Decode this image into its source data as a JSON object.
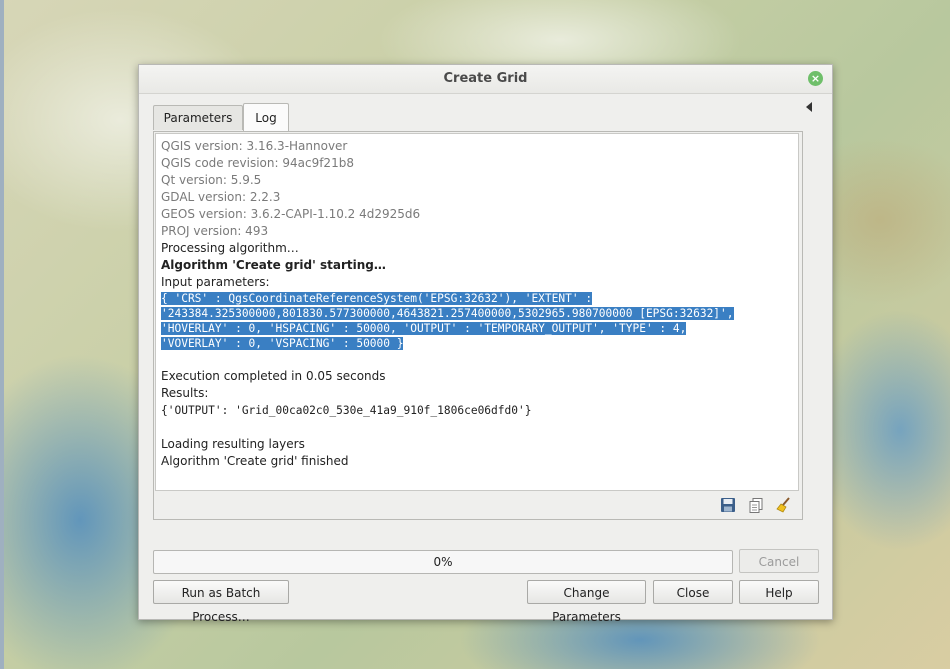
{
  "dialog": {
    "title": "Create Grid"
  },
  "tabs": {
    "parameters": "Parameters",
    "log": "Log"
  },
  "log": {
    "gray_lines": [
      "QGIS version: 3.16.3-Hannover",
      "QGIS code revision: 94ac9f21b8",
      "Qt version: 5.9.5",
      "GDAL version: 2.2.3",
      "GEOS version: 3.6.2-CAPI-1.10.2 4d2925d6",
      "PROJ version: 493"
    ],
    "processing": "Processing algorithm…",
    "starting": "Algorithm 'Create grid' starting…",
    "input_label": "Input parameters:",
    "params_lines": [
      "{ 'CRS' : QgsCoordinateReferenceSystem('EPSG:32632'), 'EXTENT' :",
      "'243384.325300000,801830.577300000,4643821.257400000,5302965.980700000 [EPSG:32632]',",
      "'HOVERLAY' : 0, 'HSPACING' : 50000, 'OUTPUT' : 'TEMPORARY_OUTPUT', 'TYPE' : 4,",
      "'VOVERLAY' : 0, 'VSPACING' : 50000 }"
    ],
    "execution": "Execution completed in 0.05 seconds",
    "results_label": "Results:",
    "results_value": "{'OUTPUT': 'Grid_00ca02c0_530e_41a9_910f_1806ce06dfd0'}",
    "loading": "Loading resulting layers",
    "finished": "Algorithm 'Create grid' finished"
  },
  "toolbar_icons": [
    "save-log-icon",
    "copy-log-icon",
    "clear-log-icon"
  ],
  "progress": {
    "value": 0,
    "label": "0%"
  },
  "buttons": {
    "cancel": "Cancel",
    "batch": "Run as Batch Process…",
    "change_params": "Change Parameters",
    "close": "Close",
    "help": "Help"
  },
  "colors": {
    "selection": "#3a7fc3",
    "close_icon": "#6fbf6a"
  }
}
